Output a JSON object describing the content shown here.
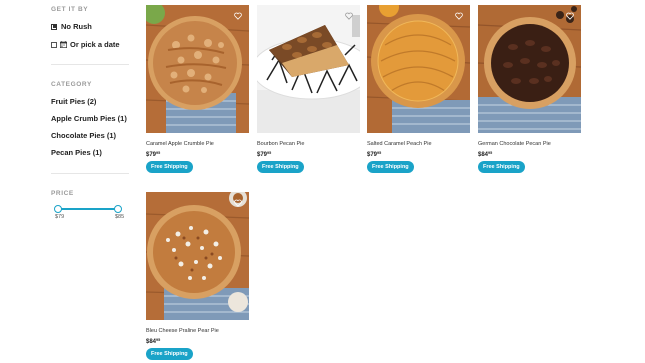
{
  "sidebar": {
    "get_it_by": {
      "heading": "GET IT BY",
      "no_rush_label": "No Rush",
      "pick_date_label": "Or pick a date"
    },
    "category": {
      "heading": "CATEGORY",
      "items": [
        {
          "label": "Fruit Pies (2)"
        },
        {
          "label": "Apple Crumb Pies (1)"
        },
        {
          "label": "Chocolate Pies (1)"
        },
        {
          "label": "Pecan Pies (1)"
        }
      ]
    },
    "price": {
      "heading": "PRICE",
      "min_label": "$79",
      "max_label": "$85",
      "range_min_fraction": 0.0,
      "range_max_fraction": 1.0
    }
  },
  "products": [
    {
      "name": "Caramel Apple Crumble Pie",
      "price_whole": "$79",
      "price_cents": "95",
      "shipping": "Free Shipping",
      "icon": "heart-icon"
    },
    {
      "name": "Bourbon Pecan Pie",
      "price_whole": "$79",
      "price_cents": "95",
      "shipping": "Free Shipping",
      "icon": "heart-icon"
    },
    {
      "name": "Salted Caramel Peach Pie",
      "price_whole": "$79",
      "price_cents": "95",
      "shipping": "Free Shipping",
      "icon": "heart-icon"
    },
    {
      "name": "German Chocolate Pecan Pie",
      "price_whole": "$84",
      "price_cents": "95",
      "shipping": "Free Shipping",
      "icon": "heart-icon"
    },
    {
      "name": "Bleu Cheese Praline Pear Pie",
      "price_whole": "$84",
      "price_cents": "95",
      "shipping": "Free Shipping",
      "icon": "heart-icon"
    }
  ],
  "colors": {
    "accent": "#1aa3c8",
    "wood": "#b06a35",
    "crust": "#c98a4a"
  }
}
